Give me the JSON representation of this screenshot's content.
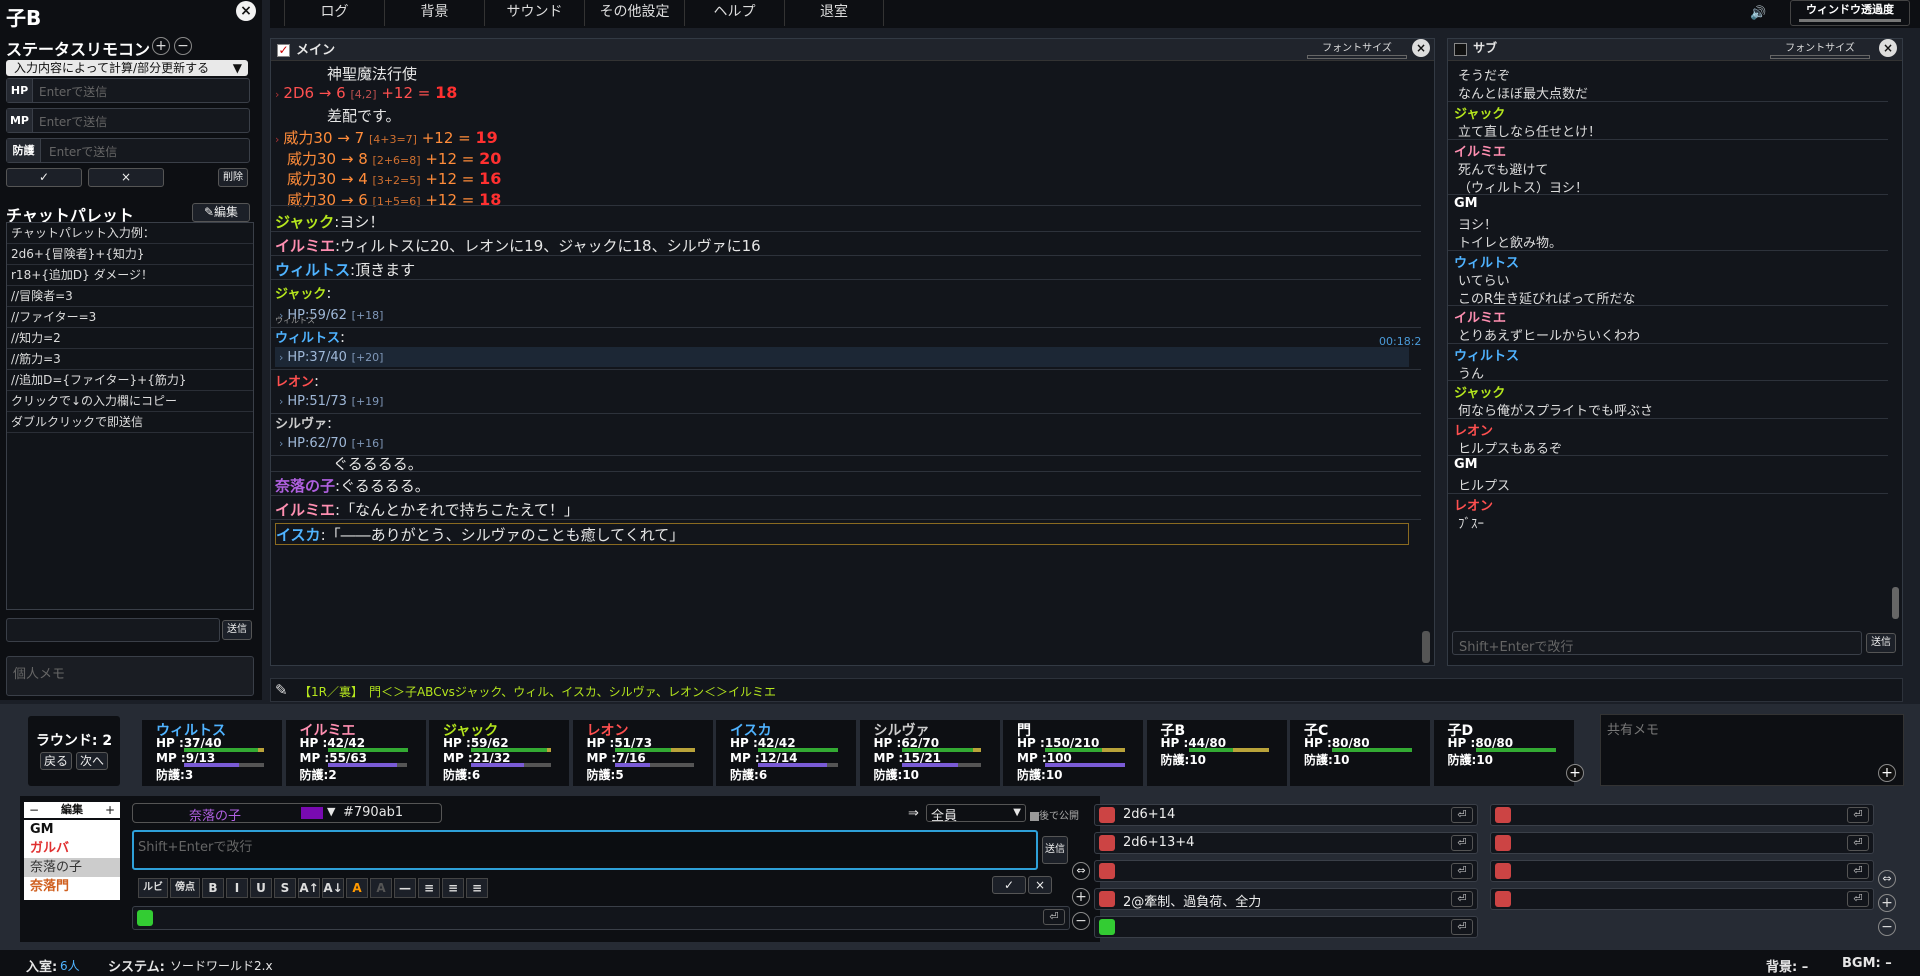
{
  "left": {
    "title": "子B",
    "remote_title": "ステータスリモコン",
    "mode": "入力内容によって計算/部分更新する",
    "inputs": [
      {
        "label": "HP",
        "placeholder": "Enterで送信"
      },
      {
        "label": "MP",
        "placeholder": "Enterで送信"
      },
      {
        "label": "防護",
        "placeholder": "Enterで送信"
      }
    ],
    "ok": "✓",
    "cancel": "×",
    "delete": "削除",
    "palette_title": "チャットパレット",
    "edit": "編集",
    "palette": [
      "チャットパレット入力例：",
      "2d6+{冒険者}+{知力}",
      "r18+{追加D} ダメージ！",
      "//冒険者=3",
      "//ファイター=3",
      "//知力=2",
      "//筋力=3",
      "//追加D={ファイター}+{筋力}",
      "クリックで↓の入力欄にコピー",
      "ダブルクリックで即送信"
    ],
    "send": "送信",
    "memo_placeholder": "個人メモ"
  },
  "menu": [
    "ログ",
    "背景",
    "サウンド",
    "その他設定",
    "ヘルプ",
    "退室"
  ],
  "opacity_label": "ウィンドウ透過度",
  "main": {
    "title": "メイン",
    "fontsize_label": "フォントサイズ",
    "time": "00:18:20",
    "casting": "神聖魔法行使",
    "roll1": "2D6 → 6",
    "roll1_dice": "[4,2]",
    "roll1_mod": "+12 =",
    "roll1_total": "18",
    "note": "差配です。",
    "damage": [
      {
        "t": "威力30 → 7",
        "d": "[4+3=7]",
        "m": "+12 =",
        "v": "19"
      },
      {
        "t": "威力30 → 8",
        "d": "[2+6=8]",
        "m": "+12 =",
        "v": "20"
      },
      {
        "t": "威力30 → 4",
        "d": "[3+2=5]",
        "m": "+12 =",
        "v": "16"
      },
      {
        "t": "威力30 → 6",
        "d": "[1+5=6]",
        "m": "+12 =",
        "v": "18"
      }
    ],
    "msgs": [
      {
        "name": "ジャック",
        "text": "ヨシ！",
        "color": "#b5e61d"
      },
      {
        "name": "イルミエ",
        "text": "ウィルトスに20、レオンに19、ジャックに18、シルヴァに16",
        "color": "#ff8fb1"
      },
      {
        "name": "ウィルトス",
        "text": "頂きます",
        "color": "#4fb3ff"
      }
    ],
    "hp": [
      {
        "name": "ジャック",
        "color": "#b5e61d",
        "hp": "HP:59/62",
        "plus": "[+18]"
      },
      {
        "name": "ウィルトス",
        "color": "#4fb3ff",
        "hp": "HP:37/40",
        "plus": "[+20]"
      },
      {
        "name": "レオン",
        "color": "#ff5050",
        "hp": "HP:51/73",
        "plus": "[+19]"
      },
      {
        "name": "シルヴァ",
        "color": "#cccccc",
        "hp": "HP:62/70",
        "plus": "[+16]"
      }
    ],
    "small_name": "ウィルトス",
    "guru": "ぐるるるる。",
    "end": [
      {
        "name": "奈落の子",
        "text": "ぐるるるる。",
        "color": "#b060e0"
      },
      {
        "name": "イルミエ",
        "text": "「なんとかそれで持ちこたえて！」",
        "color": "#ff8fb1"
      },
      {
        "name": "イスカ",
        "text": "「――ありがとう、シルヴァのことも癒してくれて」",
        "color": "#4fb3ff"
      }
    ]
  },
  "sub": {
    "title": "サブ",
    "fontsize_label": "フォントサイズ",
    "placeholder": "Shift+Enterで改行",
    "send": "送信",
    "top": [
      "そうだぞ",
      "なんとほぼ最大点数だ"
    ],
    "msgs": [
      {
        "name": "ジャック",
        "color": "#b5e61d",
        "lines": [
          "立て直しなら任せとけ！"
        ]
      },
      {
        "name": "イルミエ",
        "color": "#ff8fb1",
        "lines": [
          "死んでも避けて",
          "（ウィルトス）ヨシ！"
        ]
      },
      {
        "name": "GM",
        "color": "#ffffff",
        "lines": [
          "ヨシ！",
          "トイレと飲み物。"
        ]
      },
      {
        "name": "ウィルトス",
        "color": "#4fb3ff",
        "lines": [
          "いてらい",
          "このR生き延びればって所だな"
        ]
      },
      {
        "name": "イルミエ",
        "color": "#ff8fb1",
        "lines": [
          "とりあえずヒールからいくわわ"
        ]
      },
      {
        "name": "ウィルトス",
        "color": "#4fb3ff",
        "lines": [
          "うん"
        ]
      },
      {
        "name": "ジャック",
        "color": "#b5e61d",
        "lines": [
          "何なら俺がスプライトでも呼ぶさ"
        ]
      },
      {
        "name": "レオン",
        "color": "#ff5050",
        "lines": [
          "ヒルプスもあるぞ"
        ]
      },
      {
        "name": "GM",
        "color": "#ffffff",
        "lines": [
          "ヒルプス"
        ]
      },
      {
        "name": "レオン",
        "color": "#ff5050",
        "lines": [
          "ﾌﾞｽｰ"
        ]
      }
    ]
  },
  "info": "【1R／裏】　門＜＞子ABCvsジャック、ウィル、イスカ、シルヴァ、レオン＜＞イルミエ",
  "round": {
    "label": "ラウンド: 2",
    "prev": "戻る",
    "next": "次へ"
  },
  "chars": [
    {
      "name": "ウィルトス",
      "color": "#4fb3ff",
      "hp": "37/40",
      "mp": "9/13",
      "def": "3",
      "hpf": 0.925,
      "mpf": 0.69
    },
    {
      "name": "イルミエ",
      "color": "#ff8fb1",
      "hp": "42/42",
      "mp": "55/63",
      "def": "2",
      "hpf": 1,
      "mpf": 0.87
    },
    {
      "name": "ジャック",
      "color": "#b5e61d",
      "hp": "59/62",
      "mp": "21/32",
      "def": "6",
      "hpf": 0.95,
      "mpf": 0.66
    },
    {
      "name": "レオン",
      "color": "#ff5050",
      "hp": "51/73",
      "mp": "7/16",
      "def": "5",
      "hpf": 0.7,
      "mpf": 0.44
    },
    {
      "name": "イスカ",
      "color": "#4fb3ff",
      "hp": "42/42",
      "mp": "12/14",
      "def": "6",
      "hpf": 1,
      "mpf": 0.86
    },
    {
      "name": "シルヴァ",
      "color": "#cccccc",
      "hp": "62/70",
      "mp": "15/21",
      "def": "10",
      "hpf": 0.89,
      "mpf": 0.71
    },
    {
      "name": "門",
      "color": "#ffffff",
      "hp": "150/210",
      "mp": "100",
      "def": "10",
      "hpf": 0.71,
      "mpf": 1
    },
    {
      "name": "子B",
      "color": "#ffffff",
      "hp": "44/80",
      "mp": "",
      "def": "10",
      "hpf": 0.55,
      "mpf": 0
    },
    {
      "name": "子C",
      "color": "#ffffff",
      "hp": "80/80",
      "mp": "",
      "def": "10",
      "hpf": 1,
      "mpf": 0
    },
    {
      "name": "子D",
      "color": "#ffffff",
      "hp": "80/80",
      "mp": "",
      "def": "10",
      "hpf": 1,
      "mpf": 0
    }
  ],
  "labels": {
    "hp": "HP",
    "mp": "MP",
    "def": "防護"
  },
  "shared_memo": "共有メモ",
  "chat": {
    "edit": "編集",
    "names": [
      {
        "n": "GM",
        "c": "#111"
      },
      {
        "n": "ガルバ",
        "c": "#e03030"
      },
      {
        "n": "奈落の子",
        "c": "#333"
      },
      {
        "n": "奈落門",
        "c": "#d06020"
      }
    ],
    "current": "奈落の子",
    "color_hex": "#790ab1",
    "target": "全員",
    "later": "後で公開",
    "placeholder": "Shift+Enterで改行",
    "send": "送信",
    "fmt": [
      "ルビ",
      "傍点",
      "B",
      "I",
      "U",
      "S",
      "A↑",
      "A↓",
      "A",
      "A",
      "—",
      "≡",
      "≡",
      "≡"
    ]
  },
  "dice": [
    "2d6+14",
    "2d6+13+4",
    "",
    "2@牽制、過負荷、全力"
  ],
  "footer": {
    "room_label": "入室:",
    "room_count": "6人",
    "sys_label": "システム:",
    "sys": "ソードワールド2.x",
    "bg": "背景: –",
    "bgm": "BGM: –"
  }
}
